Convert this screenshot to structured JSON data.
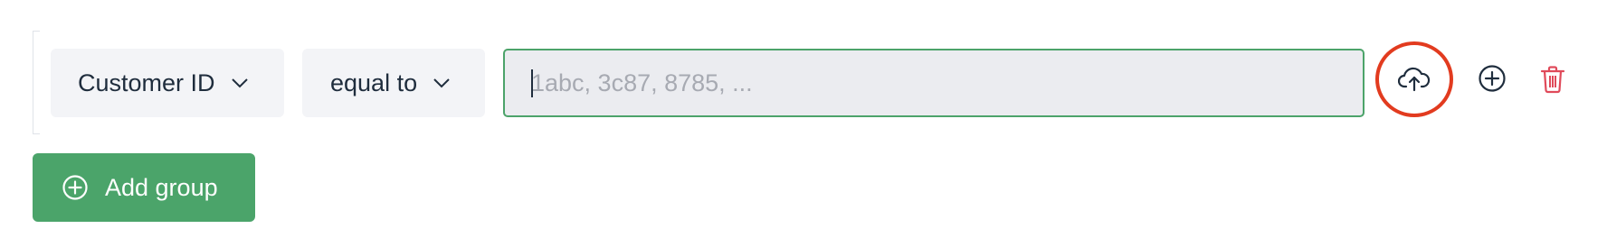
{
  "filter_row": {
    "field_select": {
      "label": "Customer ID",
      "icon": "chevron-down-icon"
    },
    "operator_select": {
      "label": "equal to",
      "icon": "chevron-down-icon"
    },
    "value_input": {
      "value": "",
      "placeholder": "1abc, 3c87, 8785, ..."
    },
    "actions": {
      "upload_icon": "cloud-upload-icon",
      "add_icon": "plus-circle-icon",
      "delete_icon": "trash-icon"
    }
  },
  "add_group_button": {
    "label": "Add group",
    "icon": "plus-circle-icon"
  },
  "colors": {
    "primary_green": "#4ba46a",
    "input_border_green": "#4ca36a",
    "delete_red": "#e04a5a",
    "highlight_ring": "#e23b1f",
    "select_bg": "#f3f4f7",
    "text": "#1f2d3d",
    "placeholder": "#a7aab2"
  }
}
